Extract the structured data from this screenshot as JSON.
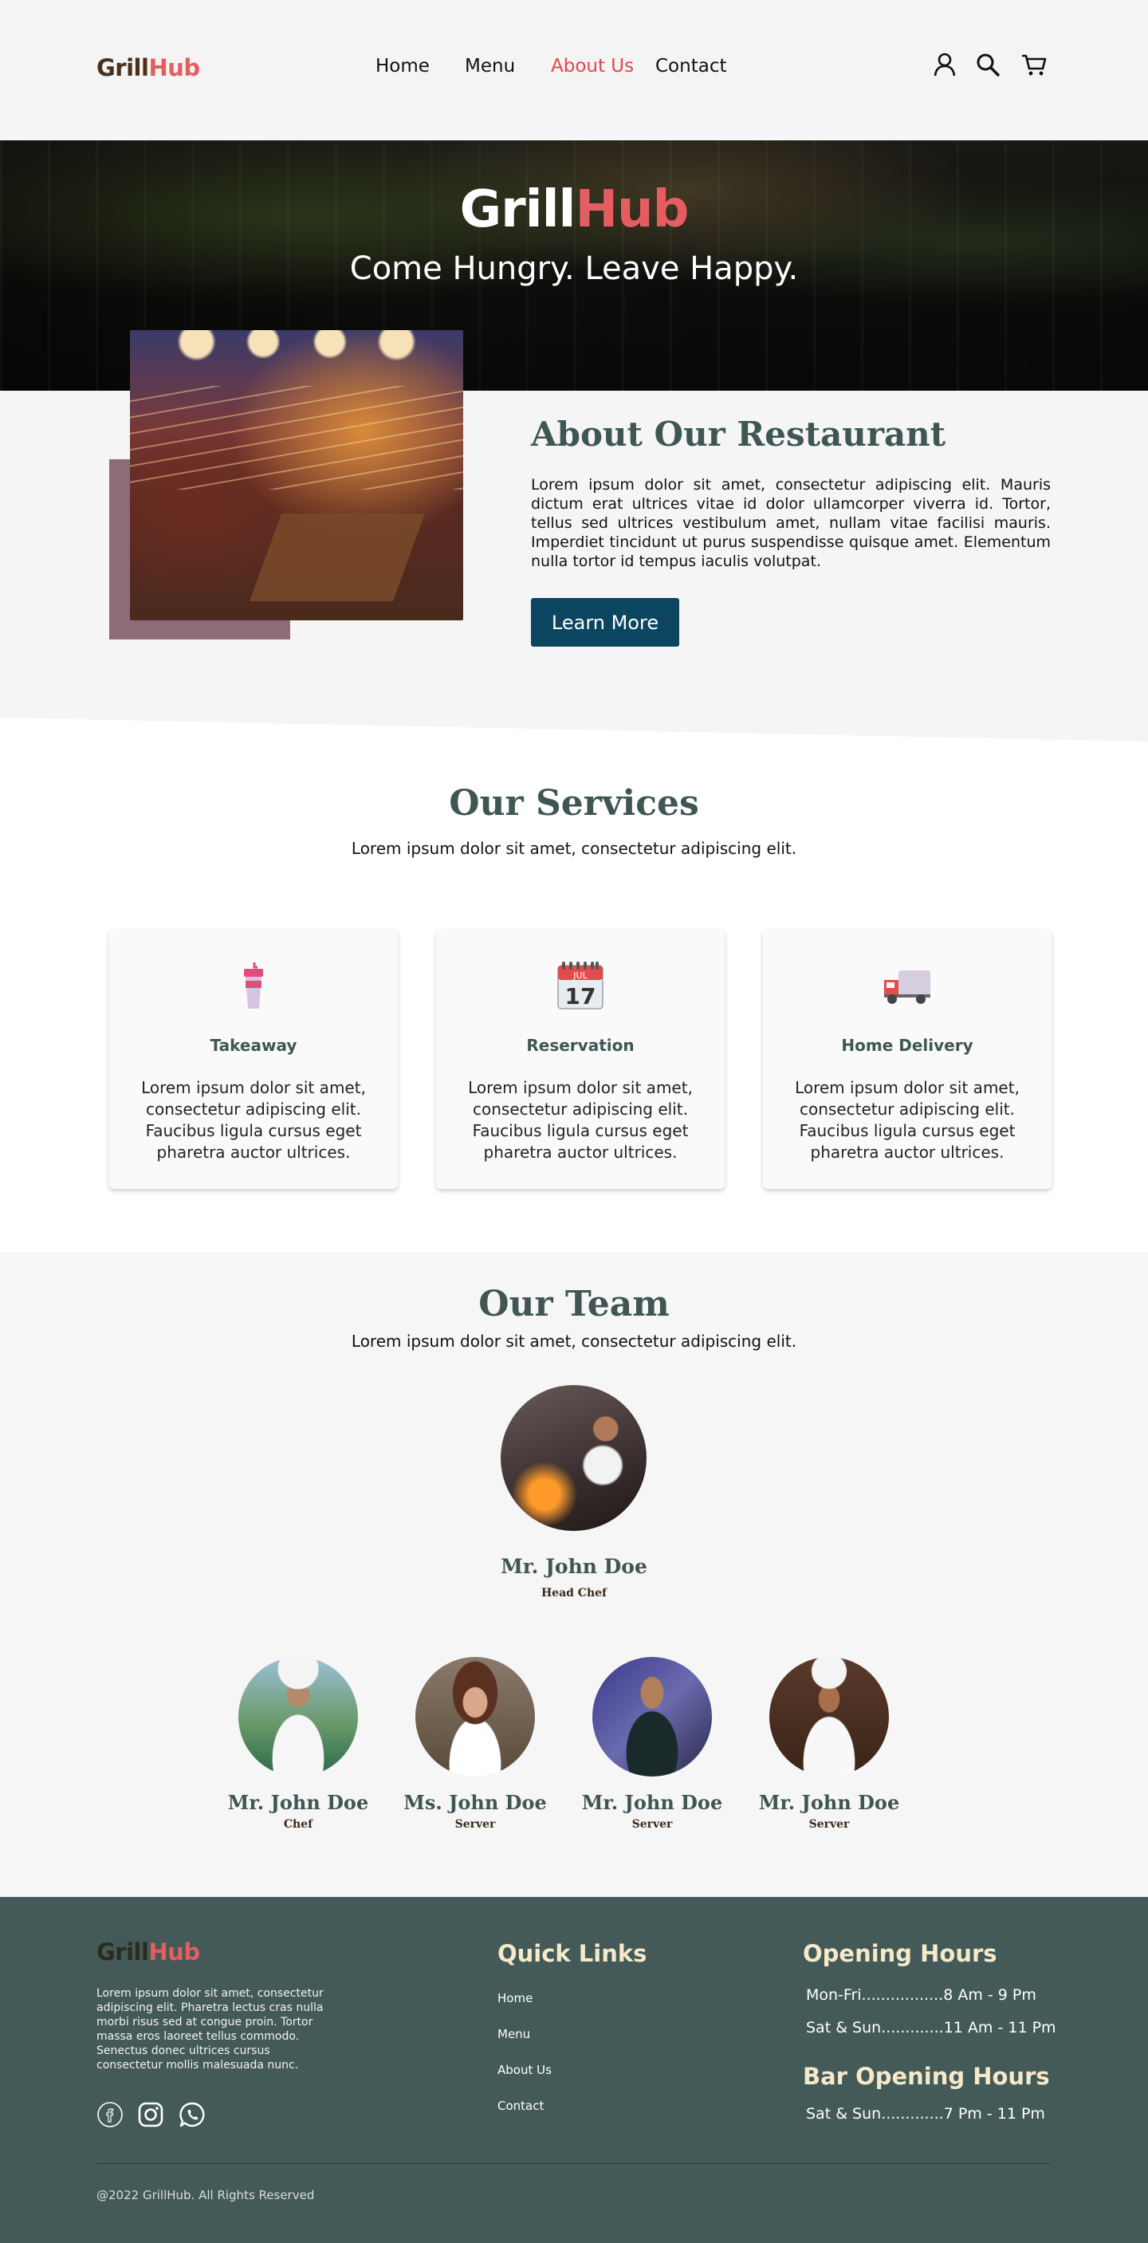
{
  "brand": {
    "part1": "Grill",
    "part2": "Hub"
  },
  "nav": {
    "items": [
      {
        "label": "Home",
        "active": false
      },
      {
        "label": "Menu",
        "active": false
      },
      {
        "label": "About Us",
        "active": true
      },
      {
        "label": "Contact",
        "active": false
      }
    ],
    "icons": [
      "user-icon",
      "search-icon",
      "cart-icon"
    ]
  },
  "hero": {
    "title_part1": "Grill",
    "title_part2": "Hub",
    "tagline": "Come Hungry. Leave Happy."
  },
  "about": {
    "title": "About Our Restaurant",
    "text": "Lorem ipsum dolor sit amet, consectetur adipiscing elit. Mauris dictum erat ultrices vitae id dolor ullamcorper viverra id. Tortor, tellus sed ultrices vestibulum amet, nullam vitae facilisi mauris. Imperdiet tincidunt ut purus suspendisse quisque amet. Elementum nulla tortor id tempus iaculis volutpat.",
    "button_label": "Learn More"
  },
  "services": {
    "title": "Our Services",
    "subtitle": "Lorem ipsum dolor sit amet, consectetur adipiscing elit.",
    "cards": [
      {
        "icon": "takeaway-cup-icon",
        "name": "Takeaway",
        "text": "Lorem ipsum dolor sit amet, consectetur adipiscing elit. Faucibus ligula cursus eget pharetra auctor ultrices."
      },
      {
        "icon": "calendar-icon",
        "name": "Reservation",
        "text": "Lorem ipsum dolor sit amet, consectetur adipiscing elit. Faucibus ligula cursus eget pharetra auctor ultrices.",
        "calendar_month": "JUL",
        "calendar_day": "17"
      },
      {
        "icon": "delivery-truck-icon",
        "name": "Home Delivery",
        "text": "Lorem ipsum dolor sit amet, consectetur adipiscing elit. Faucibus ligula cursus eget pharetra auctor ultrices."
      }
    ]
  },
  "team": {
    "title": "Our Team",
    "subtitle": "Lorem ipsum dolor sit amet, consectetur adipiscing elit.",
    "lead": {
      "name": "Mr. John Doe",
      "role": "Head Chef"
    },
    "members": [
      {
        "name": "Mr. John Doe",
        "role": "Chef"
      },
      {
        "name": "Ms. John Doe",
        "role": "Server"
      },
      {
        "name": "Mr. John Doe",
        "role": "Server"
      },
      {
        "name": "Mr. John Doe",
        "role": "Server"
      }
    ]
  },
  "footer": {
    "about_text": "Lorem ipsum dolor sit amet, consectetur adipiscing elit. Pharetra lectus cras nulla morbi risus sed at congue proin. Tortor massa eros laoreet tellus commodo. Senectus donec ultrices cursus consectetur mollis malesuada nunc.",
    "social_icons": [
      "facebook-icon",
      "instagram-icon",
      "whatsapp-icon"
    ],
    "quick_links_title": "Quick Links",
    "quick_links": [
      "Home",
      "Menu",
      "About Us",
      "Contact"
    ],
    "opening_hours_title": "Opening Hours",
    "opening_hours": [
      "Mon-Fri.................8 Am - 9 Pm",
      "Sat & Sun.............11 Am - 11 Pm"
    ],
    "bar_hours_title": "Bar Opening Hours",
    "bar_hours": [
      "Sat & Sun.............7 Pm - 11 Pm"
    ],
    "copyright": "@2022 GrillHub. All Rights Reserved"
  },
  "colors": {
    "accent": "#e45d61",
    "heading": "#3f5653",
    "button": "#0b4560",
    "footer_bg": "#435a58",
    "about_accent_block": "#8e6b78"
  }
}
